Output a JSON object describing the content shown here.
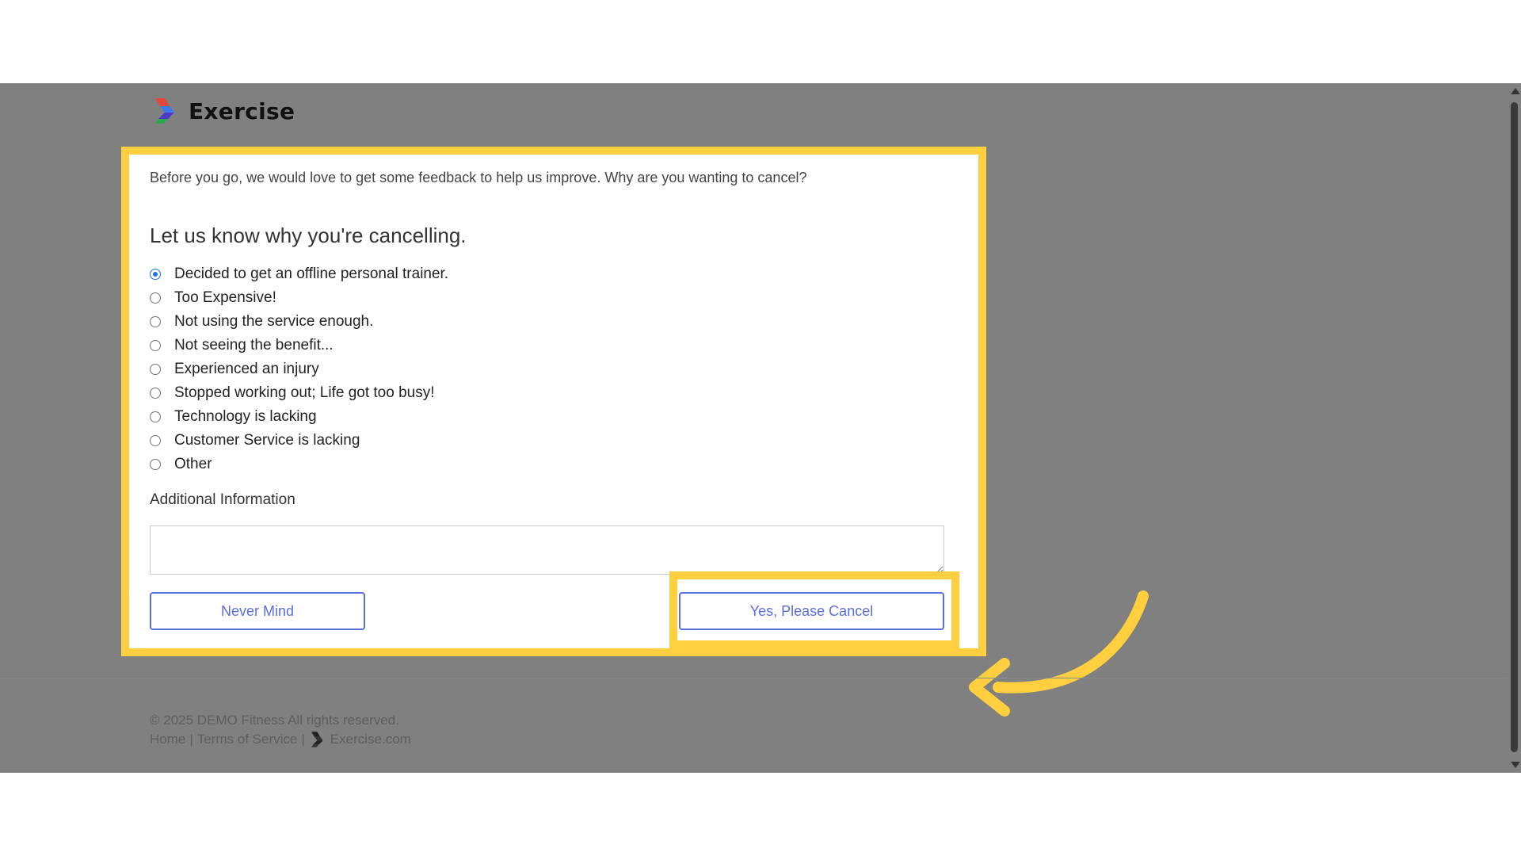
{
  "brand": {
    "name": "Exercise",
    "logo_icon": "exercise-logo-icon"
  },
  "form": {
    "intro": "Before you go, we would love to get some feedback to help us improve. Why are you wanting to cancel?",
    "heading": "Let us know why you're cancelling.",
    "reasons": [
      {
        "label": "Decided to get an offline personal trainer.",
        "checked": true
      },
      {
        "label": "Too Expensive!",
        "checked": false
      },
      {
        "label": "Not using the service enough.",
        "checked": false
      },
      {
        "label": "Not seeing the benefit...",
        "checked": false
      },
      {
        "label": "Experienced an injury",
        "checked": false
      },
      {
        "label": "Stopped working out; Life got too busy!",
        "checked": false
      },
      {
        "label": "Technology is lacking",
        "checked": false
      },
      {
        "label": "Customer Service is lacking",
        "checked": false
      },
      {
        "label": "Other",
        "checked": false
      }
    ],
    "additional_label": "Additional Information",
    "additional_value": "",
    "never_mind_label": "Never Mind",
    "cancel_label": "Yes, Please Cancel"
  },
  "footer": {
    "copyright": "© 2025 DEMO Fitness All rights reserved.",
    "home": "Home",
    "separator": "|",
    "terms": "Terms of Service",
    "exercise_link": "Exercise.com"
  },
  "colors": {
    "highlight": "#ffcf3f",
    "overlay": "#808080",
    "accent": "#5b6ee1",
    "radio_checked": "#1a73e8"
  }
}
